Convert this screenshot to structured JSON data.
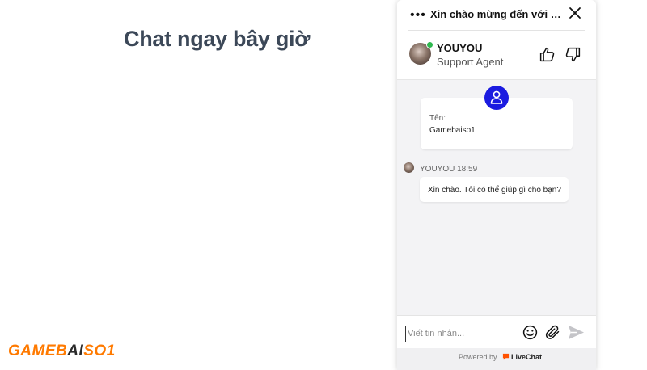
{
  "page": {
    "heading": "Chat ngay bây giờ",
    "brand": {
      "part1": "GAMEB",
      "part2": "AI",
      "part3": "SO1"
    }
  },
  "chat": {
    "header": {
      "menu_glyph": "•••",
      "title": "Xin chào mừng đến với LiveChat",
      "agent_name": "YOUYOU",
      "agent_role": "Support Agent",
      "status": "online"
    },
    "form": {
      "label": "Tên:",
      "value": "Gamebaiso1"
    },
    "messages": [
      {
        "meta": "YOUYOU 18:59",
        "text": "Xin chào. Tôi có thể giúp gì cho bạn?"
      }
    ],
    "composer": {
      "placeholder": "Viết tin nhắn...",
      "value": ""
    },
    "footer": {
      "powered_by": "Powered by",
      "brand": "LiveChat"
    }
  },
  "colors": {
    "accent": "#1b1be0",
    "brand_orange": "#ff7a00",
    "online": "#2fb84f",
    "livechat_orange": "#ff5100"
  },
  "icons": [
    "menu-dots-icon",
    "close-icon",
    "thumbs-up-icon",
    "thumbs-down-icon",
    "user-icon",
    "emoji-icon",
    "attachment-icon",
    "send-icon",
    "livechat-logo-icon"
  ]
}
